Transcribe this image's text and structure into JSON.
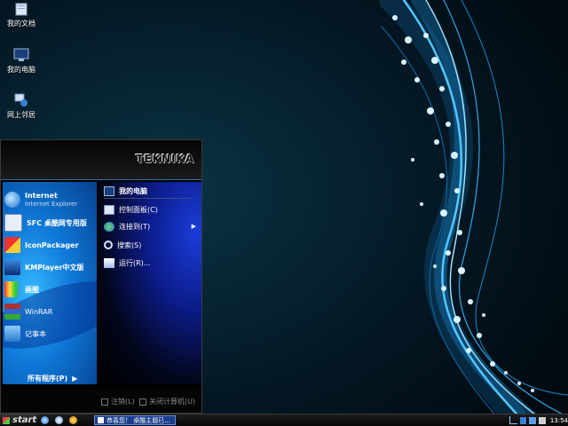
{
  "desktop": {
    "icons": [
      {
        "label": "我的文档",
        "icon": "folder-icon"
      },
      {
        "label": "我的电脑",
        "icon": "computer-icon"
      },
      {
        "label": "网上邻居",
        "icon": "network-icon"
      }
    ]
  },
  "start_menu": {
    "brand": "TEKNIKA",
    "left_items": [
      {
        "label": "Internet",
        "sublabel": "Internet Explorer",
        "icon": "globe-icon"
      },
      {
        "label": "SFC 桌酷网专用版",
        "icon": "sfc-icon"
      },
      {
        "label": "IconPackager",
        "icon": "iconpackager-icon"
      },
      {
        "label": "KMPlayer中文版",
        "icon": "kmplayer-icon"
      },
      {
        "label": "画图",
        "icon": "paint-icon"
      },
      {
        "label": "WinRAR",
        "icon": "winrar-icon"
      },
      {
        "label": "记事本",
        "icon": "notepad-icon"
      }
    ],
    "all_programs": "所有程序(P)",
    "all_programs_arrow": "▶",
    "right_items": [
      {
        "label": "我的电脑",
        "icon": "computer-icon"
      },
      {
        "label": "控制面板(C)",
        "icon": "control-panel-icon"
      },
      {
        "label": "连接到(T)",
        "icon": "connect-icon",
        "arrow": "▶"
      },
      {
        "label": "搜索(S)",
        "icon": "search-icon"
      },
      {
        "label": "运行(R)...",
        "icon": "run-icon"
      }
    ],
    "footer": {
      "logoff": "注销(L)",
      "shutdown": "关闭计算机(U)"
    }
  },
  "taskbar": {
    "start_label": "start",
    "task_label": "恭喜您！ 桌酷主题已...",
    "clock": "13:54"
  },
  "colors": {
    "accent": "#0f78d8",
    "wallpaper": "#03151f"
  }
}
